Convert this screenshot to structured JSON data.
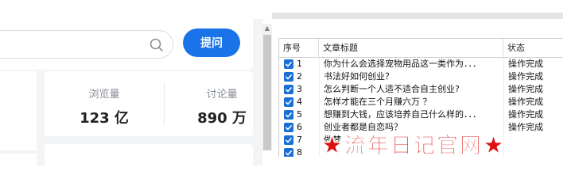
{
  "search": {
    "placeholder": "",
    "ask_label": "提问"
  },
  "stats": {
    "views_label": "浏览量",
    "views_value": "123 亿",
    "discussions_label": "讨论量",
    "discussions_value": "890 万"
  },
  "table": {
    "headers": [
      "序号",
      "文章标题",
      "状态"
    ],
    "rows": [
      {
        "num": "1",
        "title": "你为什么会选择宠物用品这一类作为．．．",
        "status": "操作完成",
        "checked": true
      },
      {
        "num": "2",
        "title": "书法好如何创业？",
        "status": "操作完成",
        "checked": true
      },
      {
        "num": "3",
        "title": "怎么判断一个人适不适合自主创业?",
        "status": "操作完成",
        "checked": true
      },
      {
        "num": "4",
        "title": "怎样才能在三个月赚六万 ？",
        "status": "操作完成",
        "checked": true
      },
      {
        "num": "5",
        "title": "想赚到大钱，应该培养自己什么样的．．．",
        "status": "操作完成",
        "checked": true
      },
      {
        "num": "6",
        "title": "创业者都是自恋吗？",
        "status": "操作完成",
        "checked": true
      },
      {
        "num": "7",
        "title": "做梦",
        "status": "",
        "checked": true
      },
      {
        "num": "8",
        "title": "",
        "status": "",
        "checked": true
      }
    ]
  },
  "watermark": "★流年日记官网★",
  "colors": {
    "accent": "#1a73e8",
    "checkbox": "#1a6fd6",
    "watermark": "#e01010"
  }
}
